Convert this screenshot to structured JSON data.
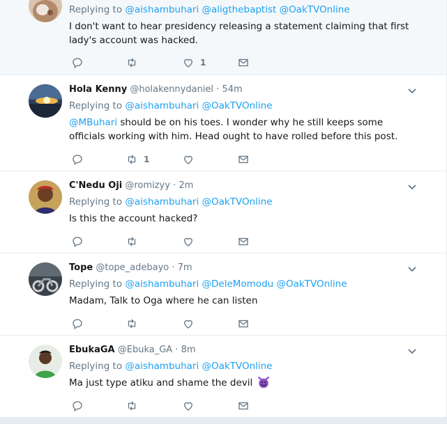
{
  "tweets": [
    {
      "name": "",
      "handle": "",
      "time": "",
      "reply_prefix": "Replying to",
      "reply_to": [
        "@aishambuhari",
        "@aligthebaptist",
        "@OakTVOnline"
      ],
      "text": "I don't want to hear presidency releasing a statement claiming that first lady's account was hacked.",
      "retweets": "",
      "likes": "1",
      "avatar_icon": "avatar-baby-icon"
    },
    {
      "name": "Hola Kenny",
      "handle": "@holakennydaniel",
      "time": "54m",
      "reply_prefix": "Replying to",
      "reply_to": [
        "@aishambuhari",
        "@OakTVOnline"
      ],
      "text_mention": "@MBuhari",
      "text": " should be on his toes. I wonder why he still keeps some officials working with him. Head ought to have rolled before this post.",
      "retweets": "1",
      "likes": "",
      "avatar_icon": "avatar-sunset-icon"
    },
    {
      "name": "C'Nedu Oji",
      "handle": "@romizyy",
      "time": "2m",
      "reply_prefix": "Replying to",
      "reply_to": [
        "@aishambuhari",
        "@OakTVOnline"
      ],
      "text": "Is this the account hacked?",
      "retweets": "",
      "likes": "",
      "avatar_icon": "avatar-portrait-icon"
    },
    {
      "name": "Tope",
      "handle": "@tope_adebayo",
      "time": "7m",
      "reply_prefix": "Replying to",
      "reply_to": [
        "@aishambuhari",
        "@DeleMomodu",
        "@OakTVOnline"
      ],
      "text": "Madam, Talk to Oga where he can listen",
      "retweets": "",
      "likes": "",
      "avatar_icon": "avatar-motorcycle-icon"
    },
    {
      "name": "EbukaGA",
      "handle": "@Ebuka_GA",
      "time": "8m",
      "reply_prefix": "Replying to",
      "reply_to": [
        "@aishambuhari",
        "@OakTVOnline"
      ],
      "text": "Ma just type atiku and shame the devil",
      "retweets": "",
      "likes": "",
      "avatar_icon": "avatar-person-icon",
      "emoji_icon": "smiling-devil-emoji-icon"
    }
  ],
  "separator": "·",
  "colors": {
    "link": "#1da1f2",
    "muted": "#657786",
    "text": "#14171a",
    "background": "#e6ecf0"
  }
}
